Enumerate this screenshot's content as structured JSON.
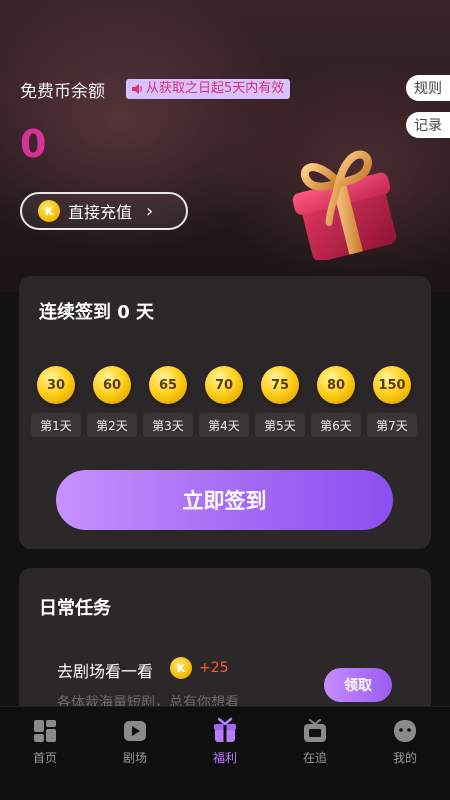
{
  "header": {
    "balance_label": "免费币余额",
    "validity_badge": "从获取之日起5天内有效",
    "balance_value": "0",
    "recharge_button": "直接充值",
    "coin_letter": "K",
    "rules_label": "规则",
    "records_label": "记录"
  },
  "checkin": {
    "title": "连续签到 0 天",
    "days": [
      {
        "amount": "30",
        "label": "第1天"
      },
      {
        "amount": "60",
        "label": "第2天"
      },
      {
        "amount": "65",
        "label": "第3天"
      },
      {
        "amount": "70",
        "label": "第4天"
      },
      {
        "amount": "75",
        "label": "第5天"
      },
      {
        "amount": "80",
        "label": "第6天"
      },
      {
        "amount": "150",
        "label": "第7天"
      }
    ],
    "button_label": "立即签到"
  },
  "tasks": {
    "title": "日常任务",
    "items": [
      {
        "name": "去剧场看一看",
        "reward": "+25",
        "description": "各体裁海量短剧，总有你想看",
        "button_label": "领取"
      }
    ]
  },
  "tabbar": {
    "items": [
      {
        "label": "首页",
        "icon": "home-icon",
        "active": false
      },
      {
        "label": "剧场",
        "icon": "theater-icon",
        "active": false
      },
      {
        "label": "福利",
        "icon": "gift-icon",
        "active": true
      },
      {
        "label": "在追",
        "icon": "following-tv-icon",
        "active": false
      },
      {
        "label": "我的",
        "icon": "profile-icon",
        "active": false
      }
    ]
  },
  "colors": {
    "accent": "#a86df5",
    "balance": "#d6339a",
    "reward": "#ff5a2e",
    "badge_text": "#e0306e"
  }
}
